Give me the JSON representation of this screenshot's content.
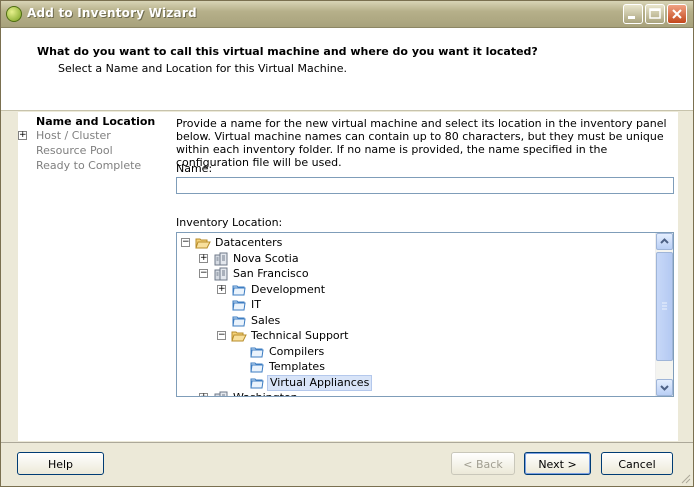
{
  "window": {
    "title": "Add to Inventory Wizard"
  },
  "header": {
    "title": "What do you want to call this virtual machine and where do you want it located?",
    "subtitle": "Select a Name and Location for this Virtual Machine."
  },
  "nav": {
    "items": [
      {
        "label": "Name and Location",
        "active": true
      },
      {
        "label": "Host / Cluster",
        "expandable": true
      },
      {
        "label": "Resource Pool"
      },
      {
        "label": "Ready to Complete"
      }
    ]
  },
  "content": {
    "description": "Provide a name for the new virtual machine and select its location in the inventory panel below. Virtual machine names can contain up to 80 characters, but they must be unique within each inventory folder. If no name is provided, the name specified in the configuration file will be used.",
    "name_label": "Name:",
    "name_value": "",
    "inventory_label": "Inventory Location:"
  },
  "tree": [
    {
      "label": "Datacenters",
      "icon": "folder-open-icon",
      "level": 0,
      "expander": "−"
    },
    {
      "label": "Nova Scotia",
      "icon": "datacenter-icon",
      "level": 1,
      "expander": "+"
    },
    {
      "label": "San Francisco",
      "icon": "datacenter-icon",
      "level": 1,
      "expander": "−"
    },
    {
      "label": "Development",
      "icon": "folder-icon",
      "level": 2,
      "expander": "+"
    },
    {
      "label": "IT",
      "icon": "folder-icon",
      "level": 2
    },
    {
      "label": "Sales",
      "icon": "folder-icon",
      "level": 2
    },
    {
      "label": "Technical Support",
      "icon": "folder-open-icon",
      "level": 2,
      "expander": "−"
    },
    {
      "label": "Compilers",
      "icon": "folder-icon",
      "level": 3
    },
    {
      "label": "Templates",
      "icon": "folder-icon",
      "level": 3
    },
    {
      "label": "Virtual Appliances",
      "icon": "folder-icon",
      "level": 3,
      "selected": true
    },
    {
      "label": "Washington",
      "icon": "datacenter-icon",
      "level": 1,
      "expander": "+"
    }
  ],
  "buttons": {
    "help": "Help",
    "back": "< Back",
    "next": "Next >",
    "cancel": "Cancel"
  },
  "colors": {
    "titlebar": "#b6b08a",
    "selection": "#d8e4f8",
    "scrollbar": "#b9cff5"
  }
}
